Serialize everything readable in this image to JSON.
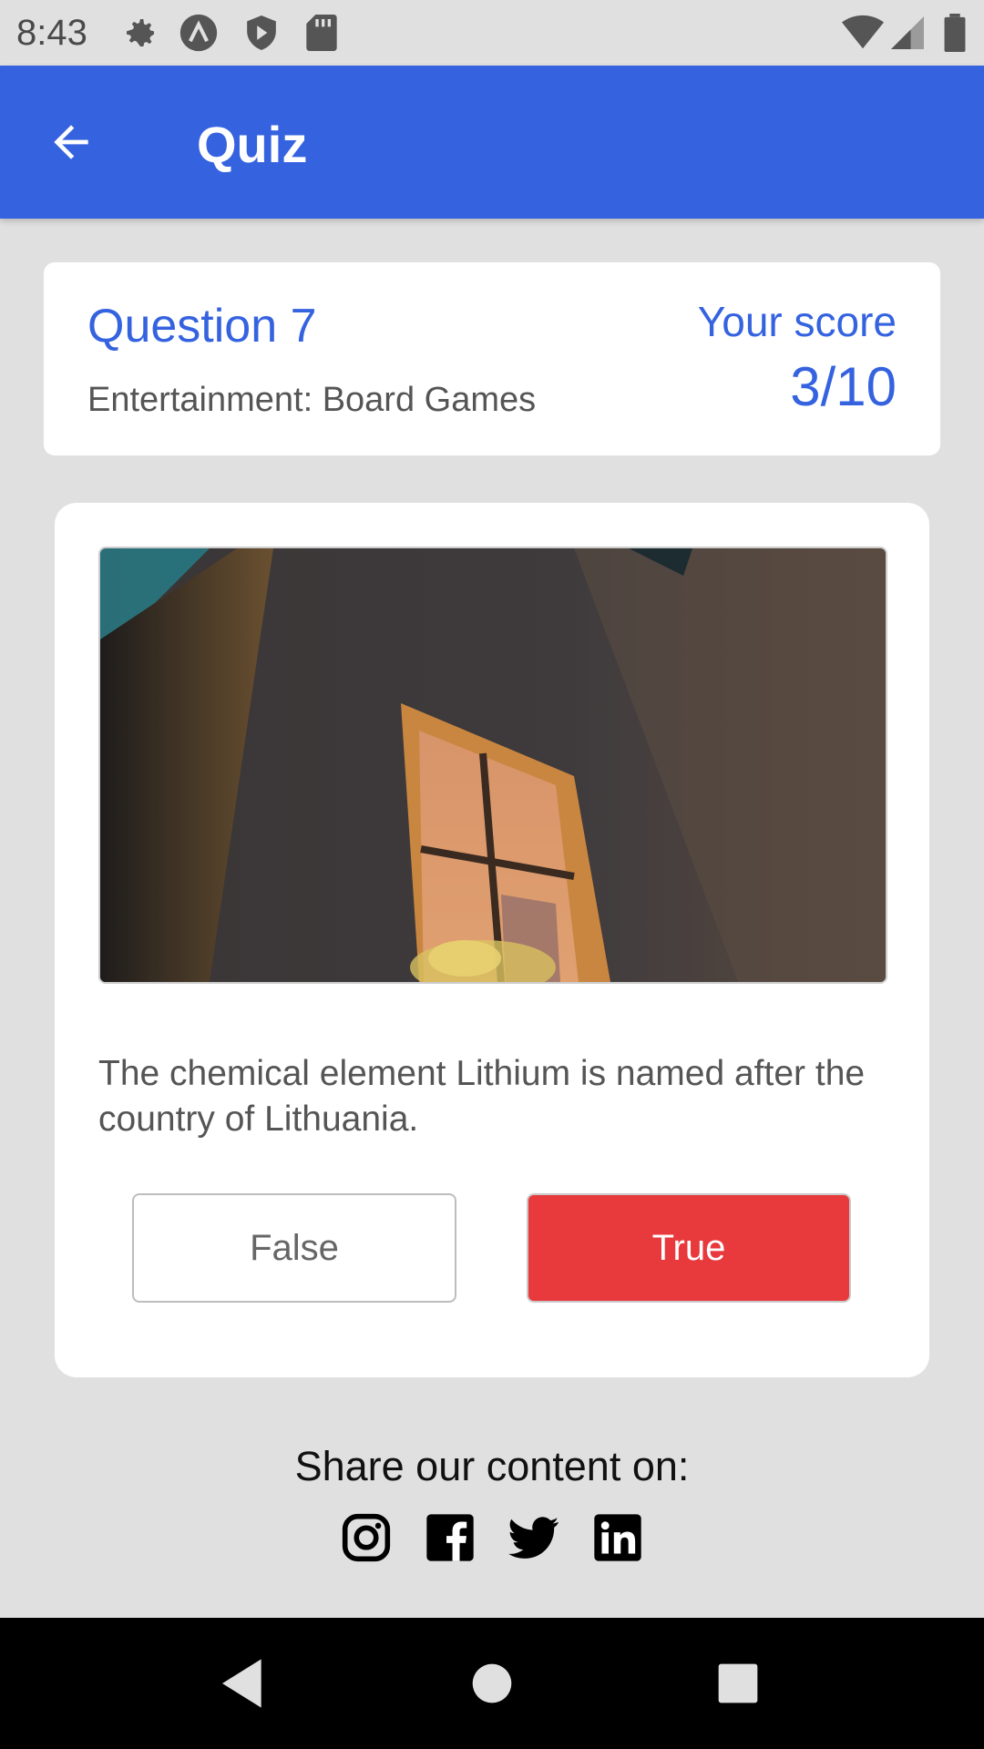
{
  "status_bar": {
    "time": "8:43",
    "icons": [
      "settings-icon",
      "a-icon",
      "shield-icon",
      "sd-card-icon",
      "wifi-icon",
      "signal-icon",
      "battery-icon"
    ]
  },
  "app_bar": {
    "title": "Quiz",
    "back_icon": "arrow-back-icon",
    "color": "#3563e0"
  },
  "info": {
    "question_label": "Question 7",
    "category": "Entertainment: Board Games",
    "score_label": "Your score",
    "score_value": "3/10"
  },
  "question": {
    "text": "The chemical element Lithium is named after the country of Lithuania.",
    "answers": {
      "false_label": "False",
      "true_label": "True"
    },
    "true_color": "#e8393c"
  },
  "share": {
    "text": "Share our content on:",
    "icons": [
      "instagram-icon",
      "facebook-icon",
      "twitter-icon",
      "linkedin-icon"
    ]
  },
  "nav": {
    "icons": [
      "nav-back-icon",
      "nav-home-icon",
      "nav-recents-icon"
    ]
  }
}
